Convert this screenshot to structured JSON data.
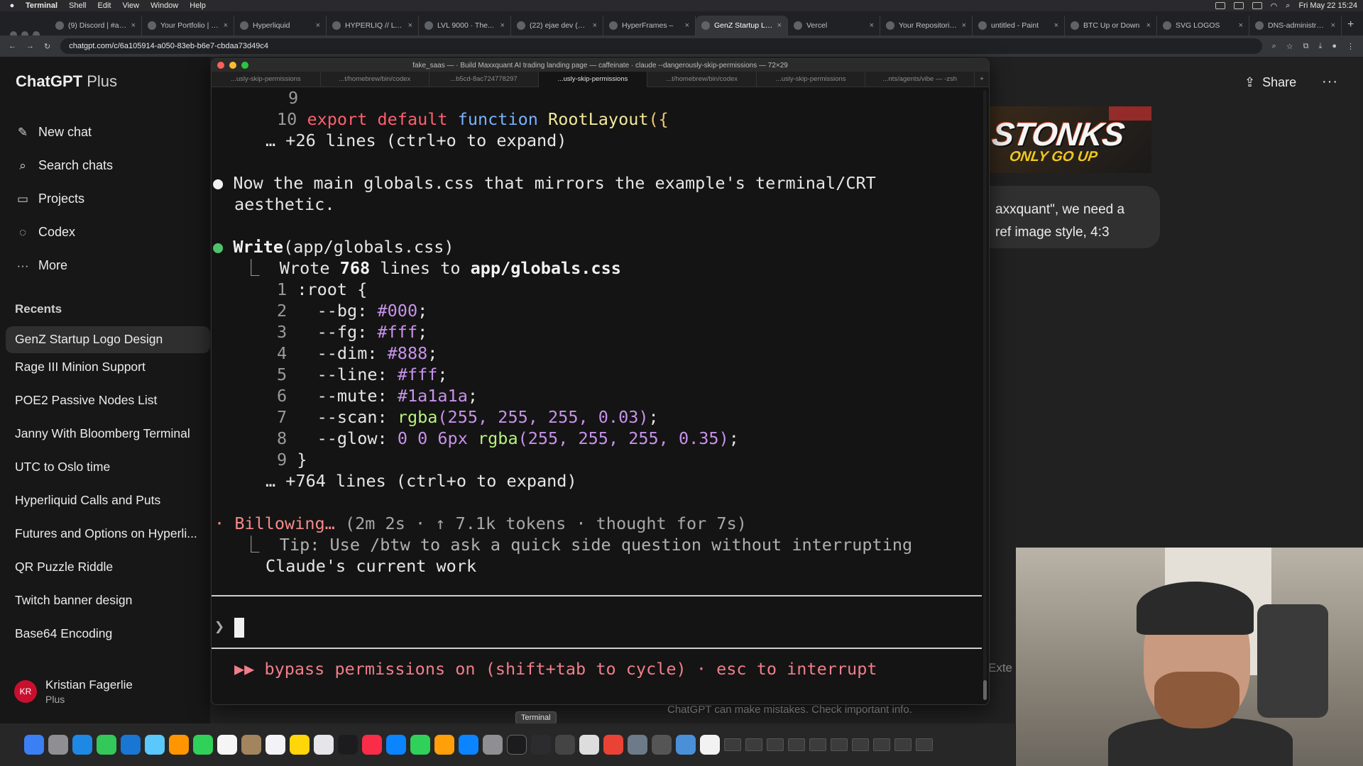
{
  "menubar": {
    "items": [
      "Terminal",
      "Shell",
      "Edit",
      "View",
      "Window",
      "Help"
    ],
    "clock": "Fri May 22  15:24"
  },
  "browser": {
    "tabs": [
      {
        "label": "(9) Discord | #al..."
      },
      {
        "label": "Your Portfolio | P..."
      },
      {
        "label": "Hyperliquid"
      },
      {
        "label": "HYPERLIQ // LVL"
      },
      {
        "label": "LVL 9000 · The..."
      },
      {
        "label": "(22) ejae dev (@..."
      },
      {
        "label": "HyperFrames –"
      },
      {
        "label": "GenZ Startup Lo..."
      },
      {
        "label": "Vercel"
      },
      {
        "label": "Your Repositorie..."
      },
      {
        "label": "untitled - Paint"
      },
      {
        "label": "BTC Up or Down"
      },
      {
        "label": "SVG LOGOS"
      },
      {
        "label": "DNS-administra..."
      }
    ],
    "active_tab": 7,
    "url": "chatgpt.com/c/6a105914-a050-83eb-b6e7-cbdaa73d49c4"
  },
  "chatgpt": {
    "brand": "ChatGPT",
    "brand_plan": "Plus",
    "nav": [
      {
        "label": "New chat",
        "icon": "pencil-square-icon"
      },
      {
        "label": "Search chats",
        "icon": "search-icon"
      },
      {
        "label": "Projects",
        "icon": "folder-icon"
      },
      {
        "label": "Codex",
        "icon": "codex-icon"
      },
      {
        "label": "More",
        "icon": "ellipsis-icon"
      }
    ],
    "recents_heading": "Recents",
    "recents": [
      "GenZ Startup Logo Design",
      "Rage III Minion Support",
      "POE2 Passive Nodes List",
      "Janny With Bloomberg Terminal",
      "UTC to Oslo time",
      "Hyperliquid Calls and Puts",
      "Futures and Options on Hyperli...",
      "QR Puzzle Riddle",
      "Twitch banner design",
      "Base64 Encoding"
    ],
    "user": {
      "initials": "KR",
      "name": "Kristian Fagerlie",
      "plan": "Plus"
    },
    "share_label": "Share",
    "image_text_main": "STONKS",
    "image_text_sub": "ONLY GO UP",
    "user_message_line1": "axxquant\", we need a",
    "user_message_line2": "ref image style, 4:3",
    "composer_partial": "Exte",
    "footer_note": "ChatGPT can make mistakes. Check important info."
  },
  "terminal": {
    "title": "fake_saas — · Build Maxxquant AI trading landing page — caffeinate · claude --dangerously-skip-permissions — 72×29",
    "tabs": [
      "...usly-skip-permissions",
      "...t/homebrew/bin/codex",
      "...b5cd-8ac724778297",
      "...usly-skip-permissions",
      "...t/homebrew/bin/codex",
      "...usly-skip-permissions",
      "...nts/agents/vibe — -zsh"
    ],
    "active_tab": 3,
    "code_top": {
      "line9": "9",
      "line10_num": "10",
      "line10_kw1": "export",
      "line10_kw2": "default",
      "line10_fn": "function",
      "line10_name": "RootLayout",
      "line10_punc": "({",
      "collapsed": "… +26 lines (ctrl+o to expand)"
    },
    "message1_line1": "Now the main globals.css that mirrors the example's terminal/CRT",
    "message1_line2": "aesthetic.",
    "write_tool": "Write",
    "write_arg": "(app/globals.css)",
    "wrote_prefix": "Wrote",
    "wrote_count": "768",
    "wrote_mid": "lines to",
    "wrote_file": "app/globals.css",
    "css": [
      {
        "num": "1",
        "text": ":root {"
      },
      {
        "num": "2",
        "prop": "--bg:",
        "val": "#000",
        "end": ";"
      },
      {
        "num": "3",
        "prop": "--fg:",
        "val": "#fff",
        "end": ";"
      },
      {
        "num": "4",
        "prop": "--dim:",
        "val": "#888",
        "end": ";"
      },
      {
        "num": "5",
        "prop": "--line:",
        "val": "#fff",
        "end": ";"
      },
      {
        "num": "6",
        "prop": "--mute:",
        "val": "#1a1a1a",
        "end": ";"
      },
      {
        "num": "7",
        "prop": "--scan:",
        "fn": "rgba",
        "val": "(255, 255, 255, 0.03)",
        "end": ";"
      },
      {
        "num": "8",
        "prop": "--glow:",
        "val0": "0 0 6px",
        "fn": "rgba",
        "val": "(255, 255, 255, 0.35)",
        "end": ";"
      },
      {
        "num": "9",
        "text": "}"
      }
    ],
    "collapsed2": "… +764 lines (ctrl+o to expand)",
    "status_word": "Billowing…",
    "status_meta": "(2m 2s · ↑ 7.1k tokens · thought for 7s)",
    "tip_line1": "Tip: Use /btw to ask a quick side question without interrupting",
    "tip_line2": "Claude's current work",
    "prompt_char": "❯",
    "footer": "▶▶ bypass permissions on (shift+tab to cycle) · esc to interrupt"
  },
  "dock": {
    "tooltip": "Terminal"
  }
}
